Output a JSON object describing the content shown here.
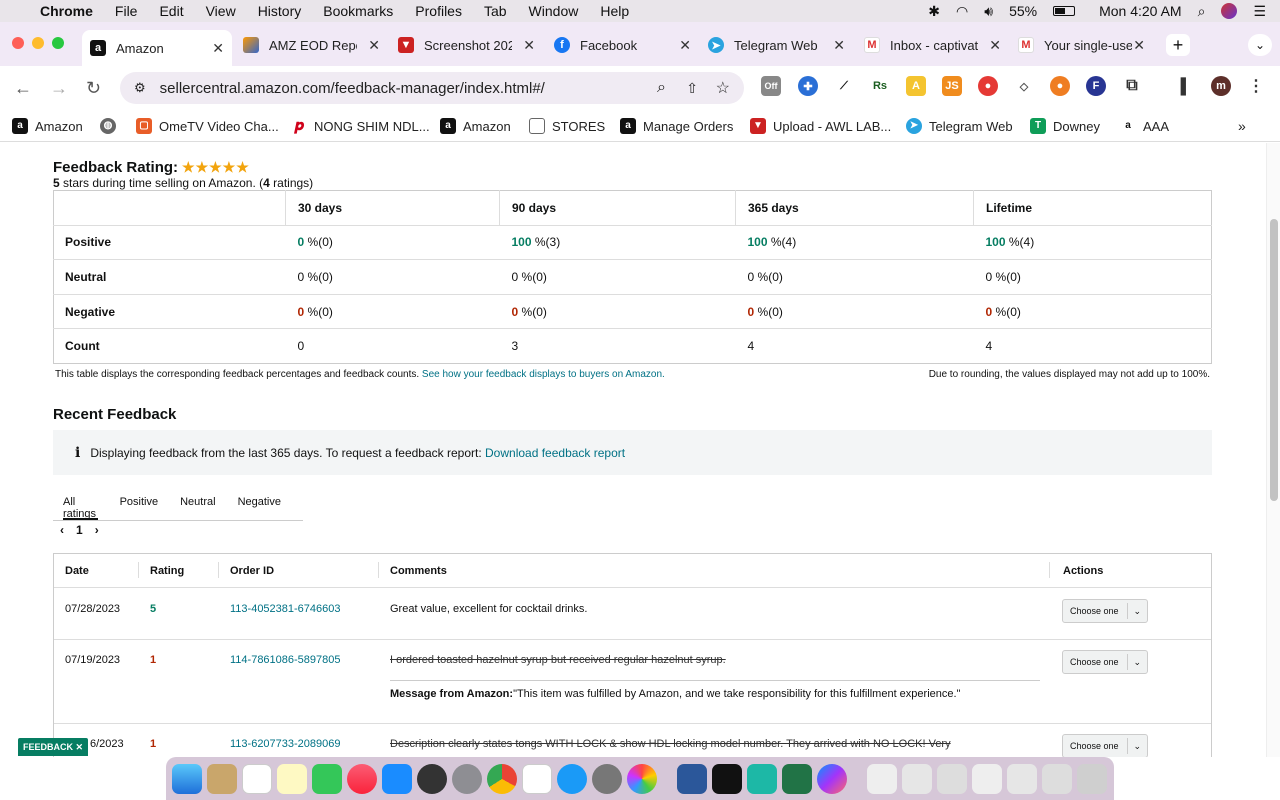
{
  "mac_menu": {
    "app": "Chrome",
    "items": [
      "File",
      "Edit",
      "View",
      "History",
      "Bookmarks",
      "Profiles",
      "Tab",
      "Window",
      "Help"
    ],
    "battery": "55%",
    "clock": "Mon 4:20 AM"
  },
  "tabs": [
    {
      "title": "Amazon",
      "active": true,
      "icon": "amazon-icon"
    },
    {
      "title": "AMZ EOD Repo",
      "icon": "sheets-icon"
    },
    {
      "title": "Screenshot 202",
      "icon": "mail-icon"
    },
    {
      "title": "Facebook",
      "icon": "facebook-icon"
    },
    {
      "title": "Telegram Web",
      "icon": "telegram-icon"
    },
    {
      "title": "Inbox - captivat",
      "icon": "gmail-icon"
    },
    {
      "title": "Your single-use",
      "icon": "gmail-icon"
    }
  ],
  "url": "sellercentral.amazon.com/feedback-manager/index.html#/",
  "ext_badge": "Off",
  "profile_initial": "m",
  "bookmarks": [
    "Amazon",
    "",
    "OmeTV Video Cha...",
    "NONG SHIM NDL...",
    "Amazon",
    "STORES",
    "Manage Orders",
    "Upload - AWL LAB...",
    "Telegram Web",
    "Downey",
    "AAA"
  ],
  "rating": {
    "title": "Feedback Rating:",
    "stars": 5,
    "stars_text": "★★★★★",
    "summary_pre": "5",
    "summary_mid": " stars during time selling on Amazon. (",
    "summary_count": "4",
    "summary_post": " ratings)"
  },
  "table": {
    "headers": [
      "30 days",
      "90 days",
      "365 days",
      "Lifetime"
    ],
    "rows": [
      {
        "label": "Positive",
        "cells": [
          [
            "0",
            "%(0)"
          ],
          [
            "100",
            "%(3)"
          ],
          [
            "100",
            "%(4)"
          ],
          [
            "100",
            "%(4)"
          ]
        ],
        "color": "green"
      },
      {
        "label": "Neutral",
        "cells": [
          [
            "0",
            "%(0)"
          ],
          [
            "0",
            "%(0)"
          ],
          [
            "0",
            "%(0)"
          ],
          [
            "0",
            "%(0)"
          ]
        ],
        "color": "none"
      },
      {
        "label": "Negative",
        "cells": [
          [
            "0",
            "%(0)"
          ],
          [
            "0",
            "%(0)"
          ],
          [
            "0",
            "%(0)"
          ],
          [
            "0",
            "%(0)"
          ]
        ],
        "color": "red"
      },
      {
        "label": "Count",
        "cells": [
          [
            "0",
            ""
          ],
          [
            "3",
            ""
          ],
          [
            "4",
            ""
          ],
          [
            "4",
            ""
          ]
        ],
        "color": "none"
      }
    ],
    "note": "This table displays the corresponding feedback percentages and feedback counts. ",
    "note_link": "See how your feedback displays to buyers on Amazon.",
    "rounding": "Due to rounding, the values displayed may not add up to 100%."
  },
  "recent": {
    "title": "Recent Feedback",
    "info": "Displaying feedback from the last 365 days. To request a feedback report: ",
    "info_link": "Download feedback report",
    "filters": [
      "All ratings",
      "Positive",
      "Neutral",
      "Negative"
    ],
    "page": "1",
    "columns": [
      "Date",
      "Rating",
      "Order ID",
      "Comments",
      "Actions"
    ],
    "rows": [
      {
        "date": "07/28/2023",
        "rating": "5",
        "order": "113-4052381-6746603",
        "comment": "Great value, excellent for cocktail drinks.",
        "struck": false,
        "action": "Choose one"
      },
      {
        "date": "07/19/2023",
        "rating": "1",
        "order": "114-7861086-5897805",
        "comment": "I ordered toasted hazelnut syrup but received regular hazelnut syrup.",
        "struck": true,
        "msg_label": "Message from Amazon:",
        "msg": " \"This item was fulfilled by Amazon, and we take responsibility for this fulfillment experience.\"",
        "action": "Choose one"
      },
      {
        "date": "6/2023",
        "rating": "1",
        "order": "113-6207733-2089069",
        "comment": "Description clearly states tongs WITH LOCK & show HDL locking model number. They arrived with NO LOCK! Very",
        "struck": true,
        "action": "Choose one"
      }
    ]
  },
  "feedback_tag": "FEEDBACK ✕"
}
